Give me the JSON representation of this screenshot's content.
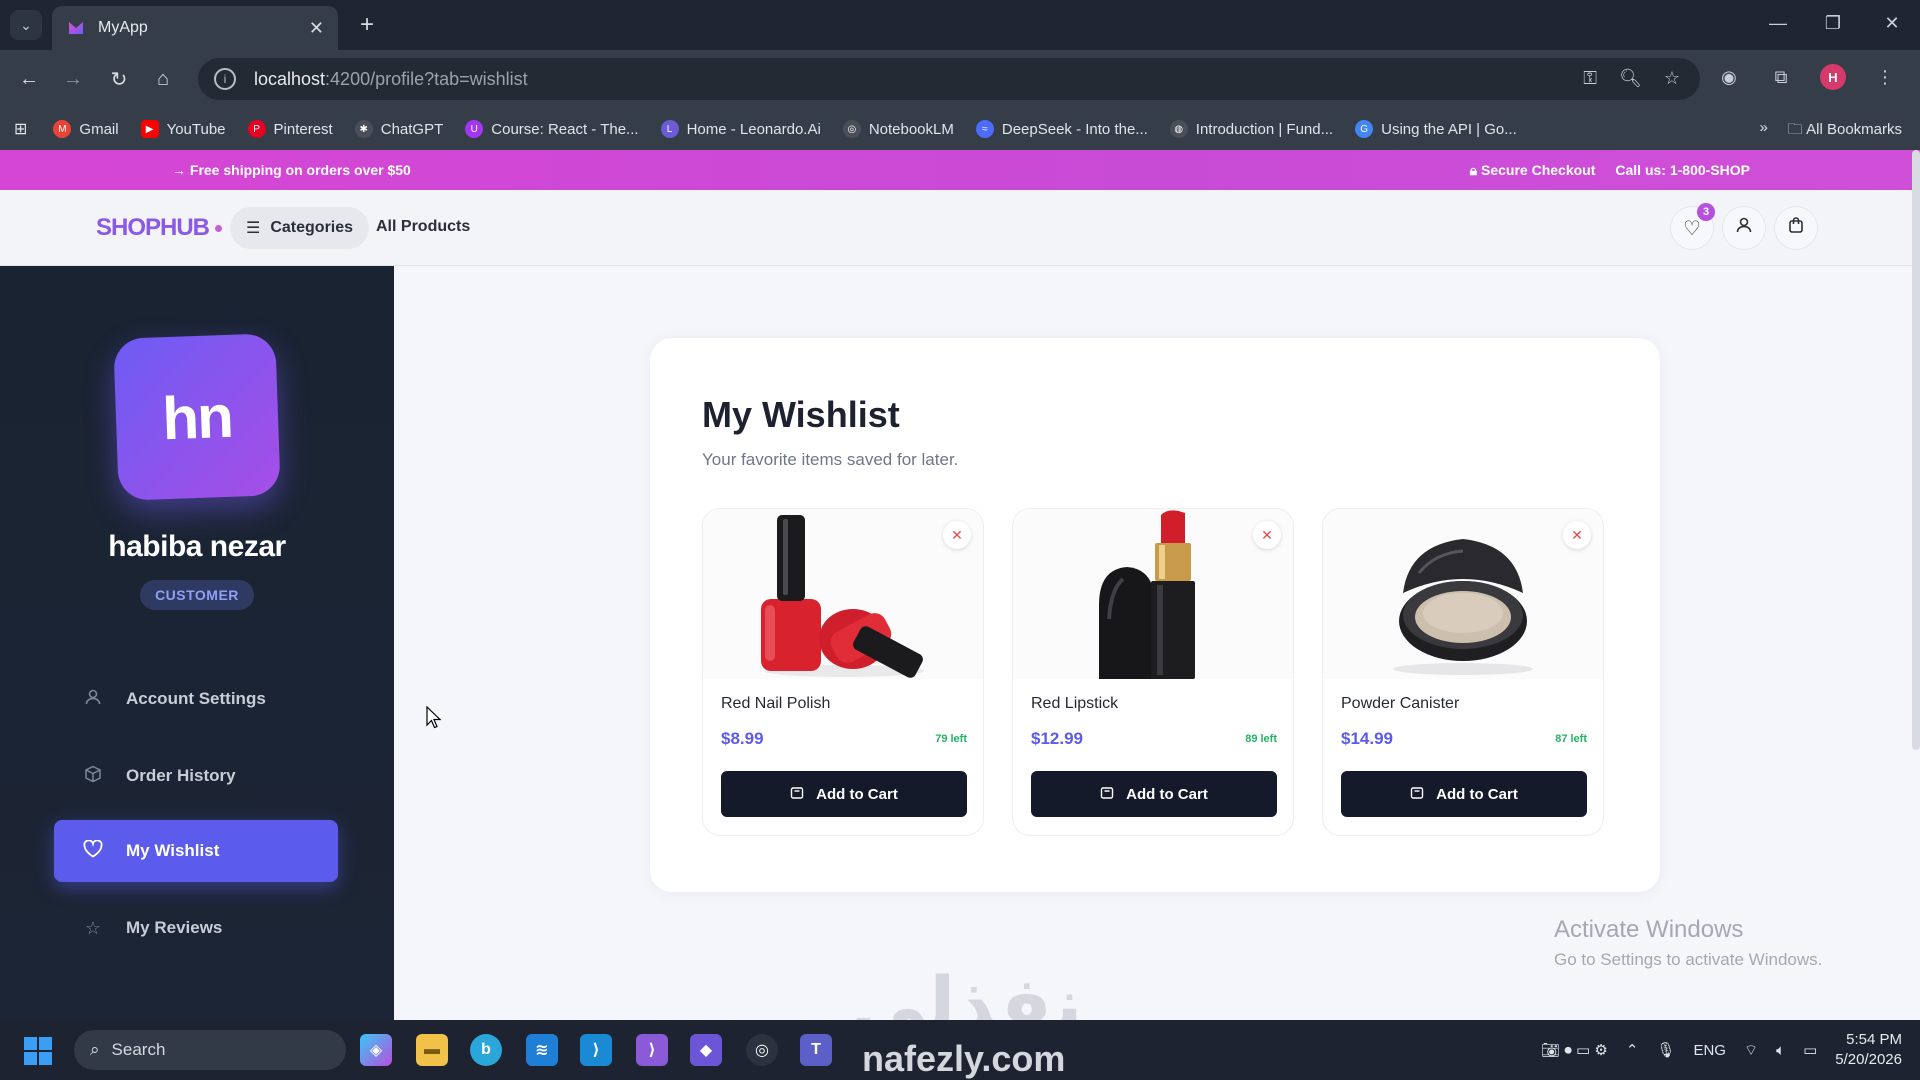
{
  "browser": {
    "tab_title": "MyApp",
    "url_host": "localhost",
    "url_path": ":4200/profile?tab=wishlist",
    "bookmarks": [
      {
        "label": "Gmail",
        "icon": "gmail-icon",
        "color": "#ea4335"
      },
      {
        "label": "YouTube",
        "icon": "youtube-icon",
        "color": "#ff0000"
      },
      {
        "label": "Pinterest",
        "icon": "pinterest-icon",
        "color": "#e60023"
      },
      {
        "label": "ChatGPT",
        "icon": "chatgpt-icon",
        "color": "#4a4f57"
      },
      {
        "label": "Course: React - The...",
        "icon": "udemy-icon",
        "color": "#a435f0"
      },
      {
        "label": "Home - Leonardo.Ai",
        "icon": "leonardo-icon",
        "color": "#6b5cd6"
      },
      {
        "label": "NotebookLM",
        "icon": "notebooklm-icon",
        "color": "#4a4f57"
      },
      {
        "label": "DeepSeek - Into the...",
        "icon": "deepseek-icon",
        "color": "#4d6bfe"
      },
      {
        "label": "Introduction | Fund...",
        "icon": "globe-icon",
        "color": "#4a4f57"
      },
      {
        "label": "Using the API  |  Go...",
        "icon": "google-icon",
        "color": "#4285f4"
      }
    ],
    "all_bookmarks_label": "All Bookmarks"
  },
  "promo": {
    "left": "Free shipping on orders over $50",
    "secure": "Secure Checkout",
    "call": "Call us: 1-800-SHOP"
  },
  "header": {
    "logo": "SHOPHUB",
    "categories_label": "Categories",
    "all_products_label": "All Products",
    "wishlist_count": "3"
  },
  "sidebar": {
    "avatar_initials": "hn",
    "username": "habiba nezar",
    "role": "CUSTOMER",
    "items": [
      {
        "label": "Account Settings",
        "icon": "user-icon"
      },
      {
        "label": "Order History",
        "icon": "box-icon"
      },
      {
        "label": "My Wishlist",
        "icon": "heart-icon",
        "active": true
      },
      {
        "label": "My Reviews",
        "icon": "star-icon"
      }
    ]
  },
  "wishlist": {
    "title": "My Wishlist",
    "subtitle": "Your favorite items saved for later.",
    "add_to_cart_label": "Add to Cart",
    "items": [
      {
        "name": "Red Nail Polish",
        "price": "$8.99",
        "stock": "79 left"
      },
      {
        "name": "Red Lipstick",
        "price": "$12.99",
        "stock": "89 left"
      },
      {
        "name": "Powder Canister",
        "price": "$14.99",
        "stock": "87 left"
      }
    ]
  },
  "windows": {
    "activate_title": "Activate Windows",
    "activate_sub": "Go to Settings to activate Windows."
  },
  "taskbar": {
    "search_placeholder": "Search",
    "lang": "ENG",
    "time": "5:54 PM",
    "date": "5/20/2026"
  },
  "overlay": {
    "watermark": "نفذلي",
    "site": "nafezly.com"
  },
  "colors": {
    "accent": "#5b5bec",
    "promo": "#d048d6",
    "sidebar_bg": "#1a2332",
    "price": "#5b5bec",
    "stock": "#25b463"
  }
}
